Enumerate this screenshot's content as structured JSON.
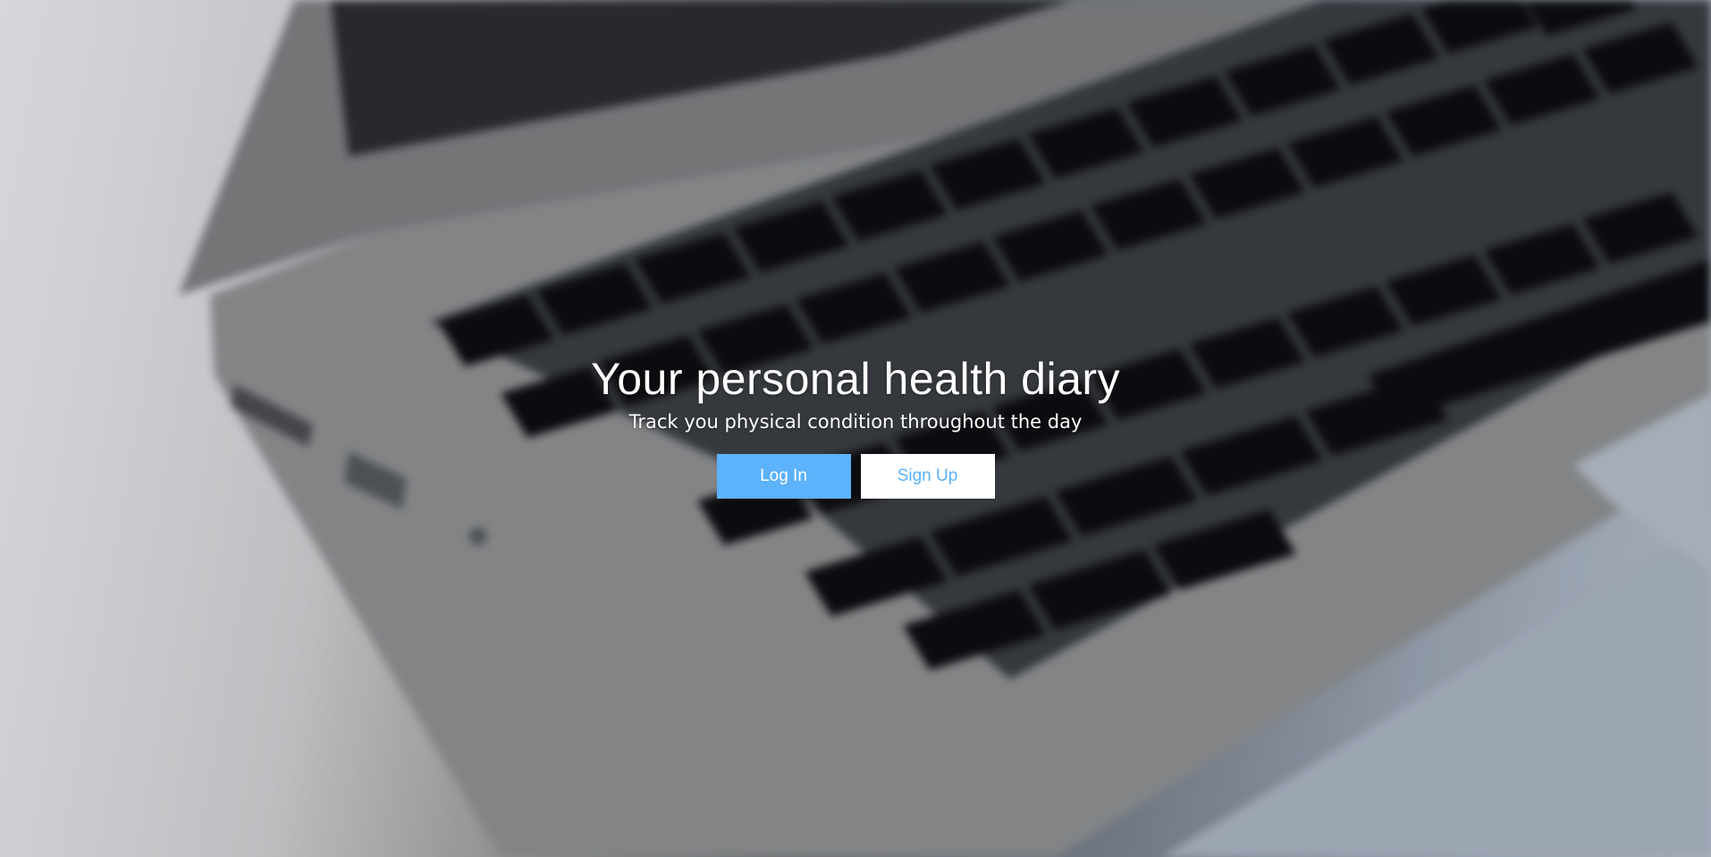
{
  "hero": {
    "title": "Your personal health diary",
    "subtitle": "Track you physical condition throughout the day",
    "background_image": "laptop-keyboard-photo"
  },
  "actions": {
    "login_label": "Log In",
    "signup_label": "Sign Up"
  },
  "colors": {
    "accent": "#5cb2fb",
    "button_text_light": "#ffffff",
    "signup_background": "#ffffff"
  }
}
